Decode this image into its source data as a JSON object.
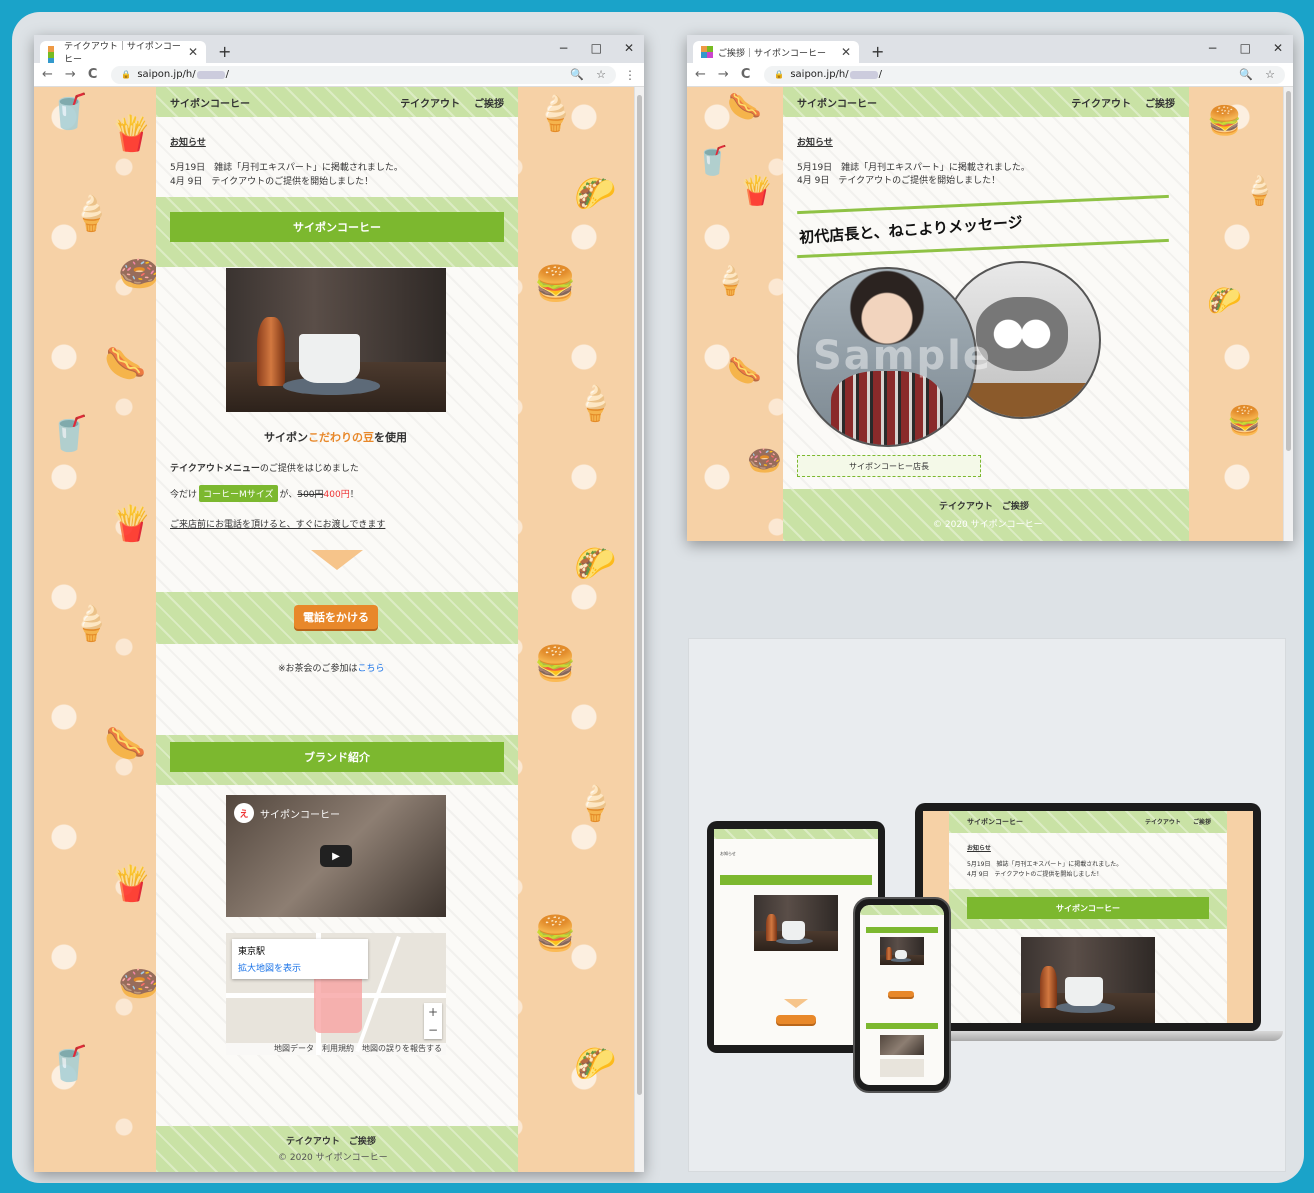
{
  "site": {
    "name": "サイポンコーヒー",
    "nav": [
      "テイクアウト",
      "ご挨拶"
    ],
    "news_heading": "お知らせ",
    "news": [
      "5月19日　雑誌「月刊エキスパート」に掲載されました。",
      "4月  9日　テイクアウトのご提供を開始しました！"
    ],
    "copyright": "© 2020 サイポンコーヒー"
  },
  "browser1": {
    "tab_title": "テイクアウト｜サイポンコーヒー",
    "url_prefix": "saipon.jp/h/",
    "url_suffix": "/",
    "section1_title": "サイポンコーヒー",
    "caption_pre": "サイポン",
    "caption_highlight": "こだわりの豆",
    "caption_post": "を使用",
    "menu_bold": "テイクアウトメニュー",
    "menu_rest": "のご提供をはじめました",
    "price_pre": "今だけ",
    "price_badge": "コーヒーMサイズ",
    "price_mid": "が、",
    "price_old": "500円",
    "price_new": "400円",
    "price_end": "！",
    "phone_note": "ご来店前にお電話を頂けると、すぐにお渡しできます",
    "call_button": "電話をかける",
    "tea_note_pre": "※お茶会のご参加は",
    "tea_note_link": "こちら",
    "section2_title": "ブランド紹介",
    "video_title": "サイポンコーヒー",
    "map_place": "東京駅",
    "map_link": "拡大地図を表示",
    "map_footer": "地図データ　利用規約　地図の誤りを報告する",
    "map_zoom_in": "+",
    "map_zoom_out": "−"
  },
  "browser2": {
    "tab_title": "ご挨拶｜サイポンコーヒー",
    "url_prefix": "saipon.jp/h/",
    "url_suffix": "/",
    "message_title": "初代店長と、ねこよりメッセージ",
    "caption": "サイポンコーヒー店長",
    "watermark": "Sample"
  },
  "window_controls": [
    "−",
    "□",
    "✕"
  ],
  "icons": {
    "add_tab": "+",
    "back": "←",
    "forward": "→",
    "reload": "C",
    "lock": "🔒",
    "zoom": "🔍",
    "star": "☆",
    "menu": "⋮",
    "tab_close": "✕",
    "play": "▶"
  },
  "colors": {
    "frame": "#1aa3c9",
    "accent_green": "#7cb82f",
    "accent_orange": "#e8882a",
    "bg_peach": "#f6d1a6"
  }
}
